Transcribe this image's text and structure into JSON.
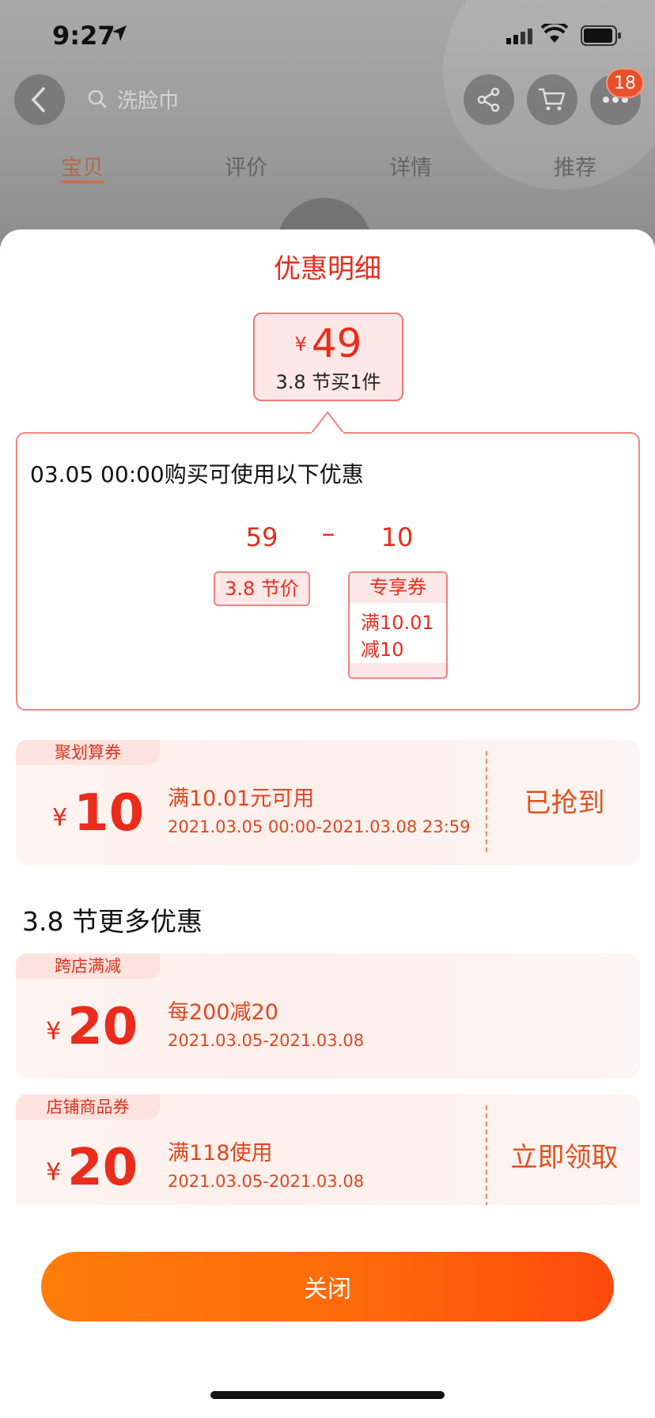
{
  "status_bar": {
    "time": "9:27"
  },
  "nav": {
    "search_placeholder": "洗脸巾",
    "cart_badge": "18"
  },
  "tabs": [
    {
      "label": "宝贝",
      "active": true
    },
    {
      "label": "评价",
      "active": false
    },
    {
      "label": "详情",
      "active": false
    },
    {
      "label": "推荐",
      "active": false
    }
  ],
  "sheet": {
    "title": "优惠明细",
    "final_price": {
      "currency": "¥",
      "amount": "49",
      "desc": "3.8 节买1件"
    },
    "detail": {
      "heading": "03.05 00:00购买可使用以下优惠",
      "base_value": "59",
      "operator": "–",
      "discount_value": "10",
      "base_tag": "3.8 节价",
      "discount_tag_title": "专享券",
      "discount_tag_line1": "满10.01",
      "discount_tag_line2": "减10"
    },
    "coupons": [
      {
        "label": "聚划算券",
        "currency": "¥",
        "amount": "10",
        "condition": "满10.01元可用",
        "date": "2021.03.05 00:00-2021.03.08 23:59",
        "action": "已抢到"
      }
    ],
    "more_title": "3.8 节更多优惠",
    "more_coupons": [
      {
        "label": "跨店满减",
        "currency": "¥",
        "amount": "20",
        "condition": "每200减20",
        "date": "2021.03.05-2021.03.08",
        "action": ""
      },
      {
        "label": "店铺商品券",
        "currency": "¥",
        "amount": "20",
        "condition": "满118使用",
        "date": "2021.03.05-2021.03.08",
        "action": "立即领取"
      }
    ],
    "close_label": "关闭"
  },
  "colors": {
    "accent_red": "#ea2c1c",
    "button_orange": "#ff6a0a"
  }
}
